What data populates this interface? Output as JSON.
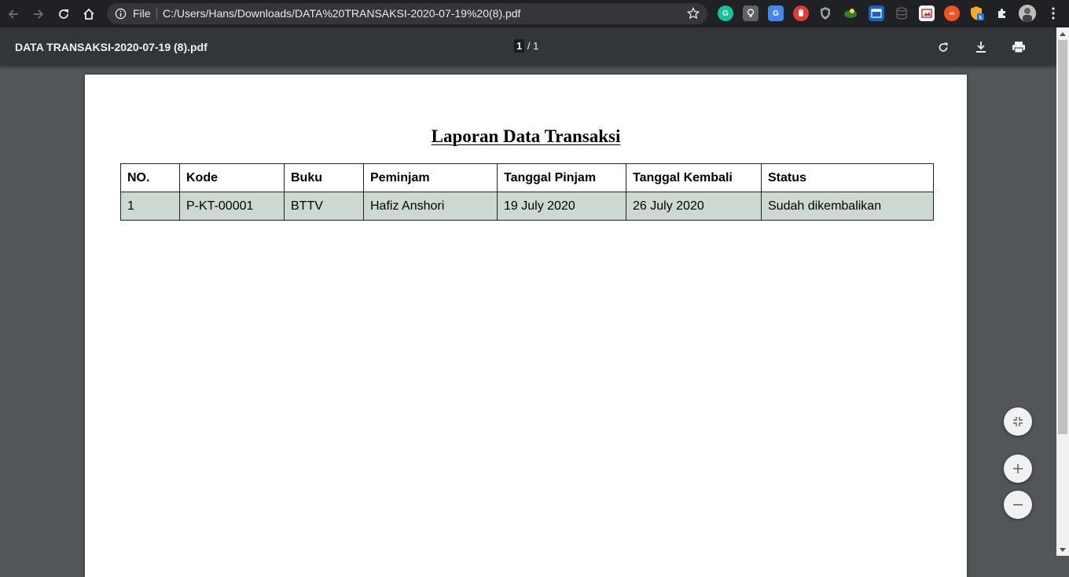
{
  "browser": {
    "omnibox": {
      "scheme_label": "File",
      "url": "C:/Users/Hans/Downloads/DATA%20TRANSAKSI-2020-07-19%20(8).pdf"
    },
    "extensions": [
      {
        "name": "grammarly-icon",
        "color": "#15c39a",
        "glyph": "G"
      },
      {
        "name": "keep-icon",
        "color": "#5f6368",
        "glyph": "💡"
      },
      {
        "name": "translate-icon",
        "color": "#4285f4",
        "glyph": "G"
      },
      {
        "name": "adblock-icon",
        "color": "#e53935",
        "glyph": "✋"
      },
      {
        "name": "shield-icon",
        "color": "#5f6368",
        "glyph": "◈"
      },
      {
        "name": "color-picker-icon",
        "color": "#2e7d32",
        "glyph": "◆"
      },
      {
        "name": "window-resizer-icon",
        "color": "#1565c0",
        "glyph": "▣"
      },
      {
        "name": "database-icon",
        "color": "#555a5e",
        "glyph": "≡"
      },
      {
        "name": "screenshot-icon",
        "color": "#d32f2f",
        "glyph": "✎"
      },
      {
        "name": "infinity-icon",
        "color": "#f4511e",
        "glyph": "∞"
      },
      {
        "name": "vpn-icon",
        "color": "#f9a825",
        "glyph": "V"
      },
      {
        "name": "extensions-puzzle-icon",
        "color": "#202124",
        "glyph": "✚"
      },
      {
        "name": "profile-avatar-icon",
        "color": "#9e9e9e",
        "glyph": "●"
      }
    ]
  },
  "pdf": {
    "file_title": "DATA TRANSAKSI-2020-07-19 (8).pdf",
    "page_current": "1",
    "page_total": "/ 1"
  },
  "document": {
    "title": "Laporan Data Transaksi",
    "table": {
      "headers": [
        "NO.",
        "Kode",
        "Buku",
        "Peminjam",
        "Tanggal Pinjam",
        "Tanggal Kembali",
        "Status"
      ],
      "rows": [
        [
          "1",
          "P-KT-00001",
          "BTTV",
          "Hafiz Anshori",
          "19 July 2020",
          "26 July 2020",
          "Sudah dikembalikan"
        ]
      ]
    }
  }
}
